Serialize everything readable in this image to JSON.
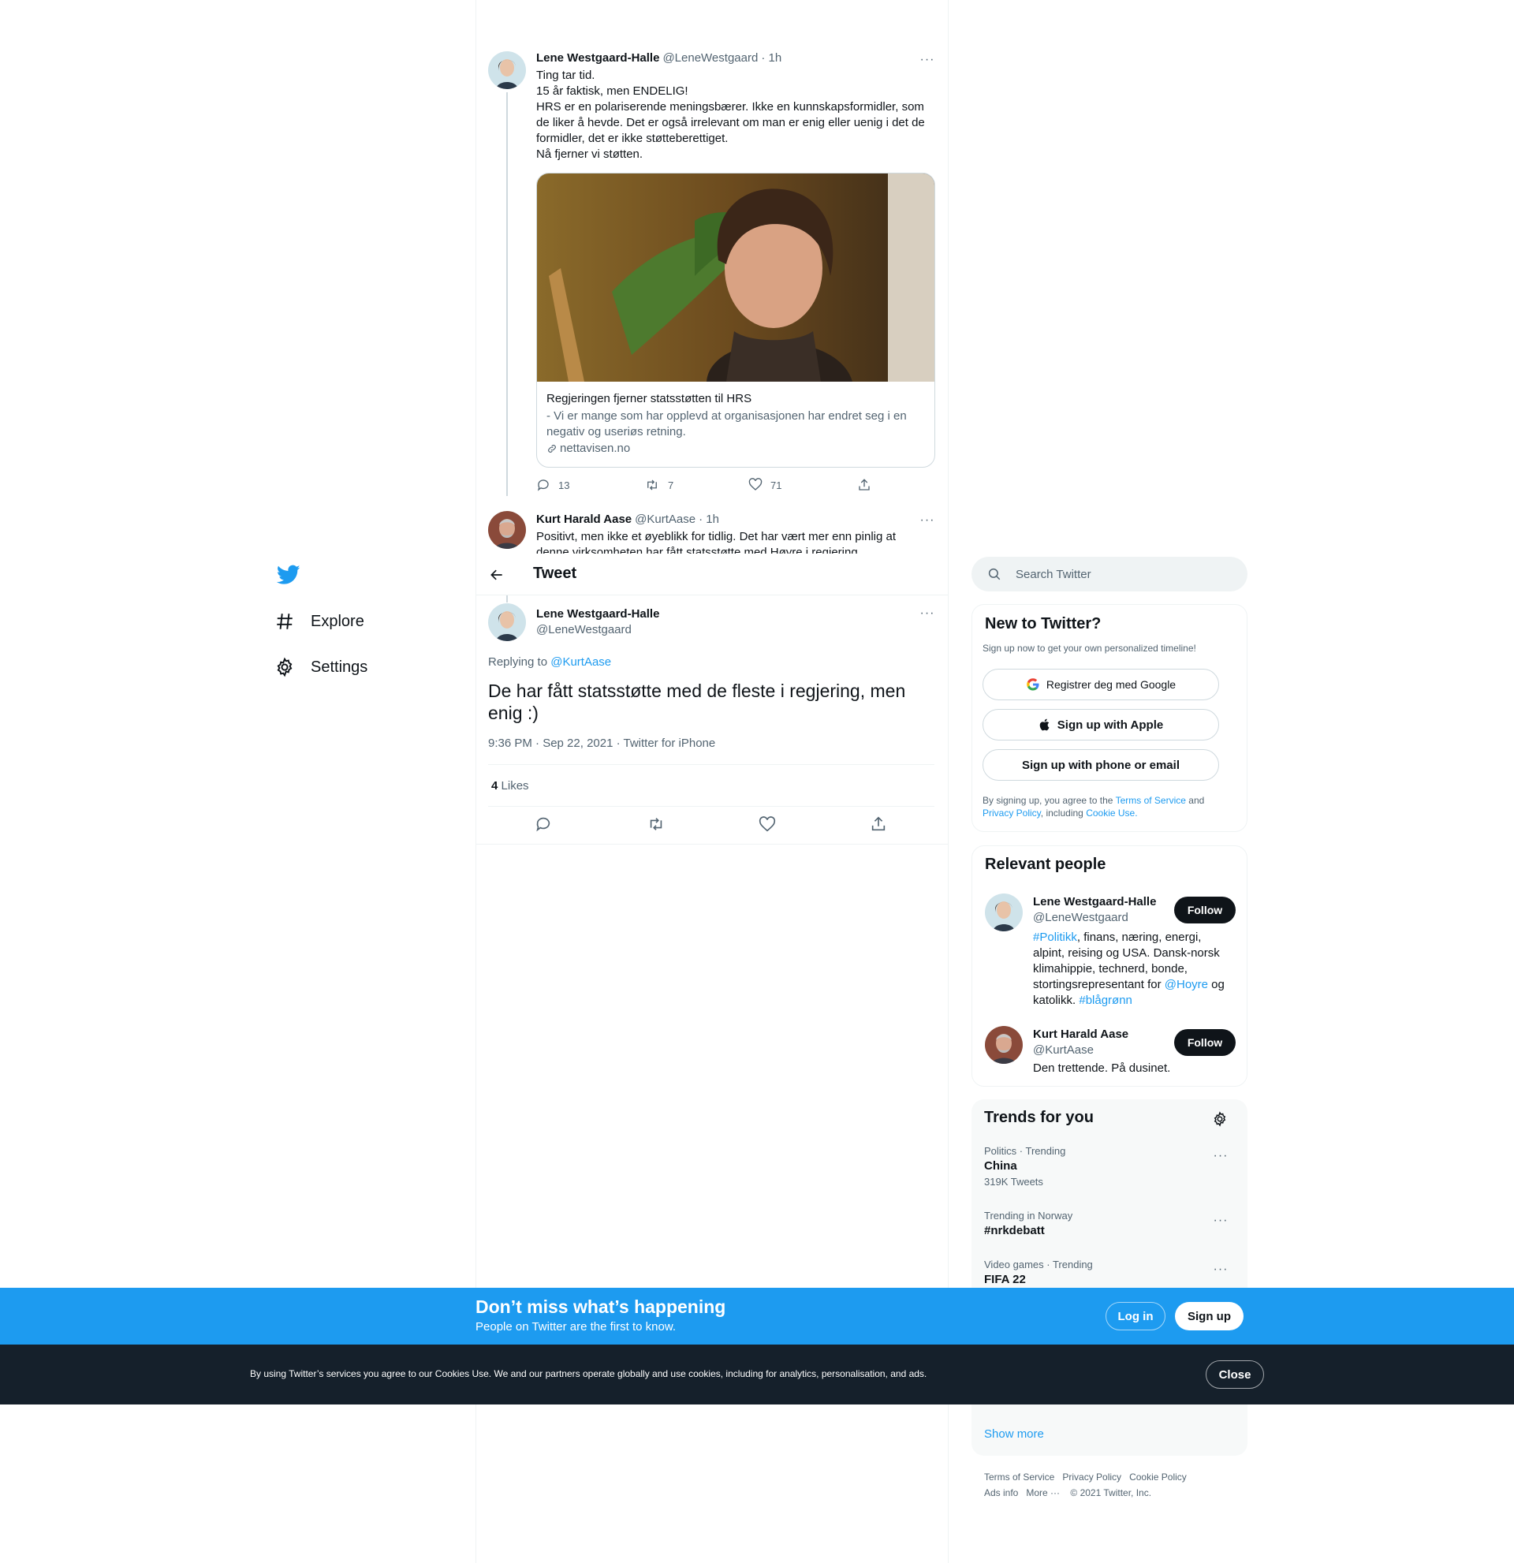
{
  "nav": {
    "explore": "Explore",
    "settings": "Settings"
  },
  "header": {
    "title": "Tweet"
  },
  "parent_tweet": {
    "name": "Lene Westgaard-Halle",
    "handle": "@LeneWestgaard",
    "time": "· 1h",
    "lines": [
      "Ting tar tid.",
      "15 år faktisk, men ENDELIG!",
      "HRS er en polariserende meningsbærer. Ikke en kunnskapsformidler, som de liker å hevde. Det er også irrelevant om man er enig eller uenig i det de formidler, det er ikke støtteberettiget.",
      "Nå fjerner vi støtten."
    ],
    "card": {
      "title": "Regjeringen fjerner statsstøtten til HRS",
      "description": "- Vi er mange som har opplevd at organisasjonen har endret seg i en negativ og useriøs retning.",
      "domain": "nettavisen.no"
    },
    "replies": "13",
    "retweets": "7",
    "likes": "71"
  },
  "mid_tweet": {
    "name": "Kurt Harald Aase",
    "handle": "@KurtAase",
    "time": "· 1h",
    "text": "Positivt, men ikke et øyeblikk for tidlig. Det har vært mer enn pinlig at denne virksomheten har fått statsstøtte med Høyre i regjering."
  },
  "main_tweet": {
    "name": "Lene Westgaard-Halle",
    "handle": "@LeneWestgaard",
    "replying_prefix": "Replying to",
    "replying_to": "@KurtAase",
    "text": "De har fått statsstøtte med de fleste i regjering, men enig :)",
    "timestamp": "9:36 PM · Sep 22, 2021 · Twitter for iPhone",
    "likes_count": "4",
    "likes_label": "Likes"
  },
  "search": {
    "placeholder": "Search Twitter"
  },
  "signup_card": {
    "title": "New to Twitter?",
    "subtitle": "Sign up now to get your own personalized timeline!",
    "google_label": "Registrer deg med Google",
    "apple_label": "Sign up with Apple",
    "phone_label": "Sign up with phone or email",
    "legal_prefix": "By signing up, you agree to the",
    "terms": "Terms of Service",
    "and": "and",
    "privacy": "Privacy Policy",
    "including": ", including",
    "cookie": "Cookie Use."
  },
  "relevant": {
    "title": "Relevant people",
    "people": [
      {
        "name": "Lene Westgaard-Halle",
        "handle": "@LeneWestgaard",
        "follow": "Follow",
        "bio_tag1": "#Politikk",
        "bio_text1": ", finans, næring, energi, alpint, reising og USA. Dansk-norsk klimahippie, technerd, bonde, stortingsrepresentant for ",
        "bio_mention": "@Hoyre",
        "bio_text2": " og katolikk. ",
        "bio_tag2": "#blågrønn"
      },
      {
        "name": "Kurt Harald Aase",
        "handle": "@KurtAase",
        "follow": "Follow",
        "bio": "Den trettende. På dusinet."
      }
    ]
  },
  "trends": {
    "title": "Trends for you",
    "items": [
      {
        "category": "Politics · Trending",
        "name": "China",
        "count": "319K Tweets"
      },
      {
        "category": "Trending in Norway",
        "name": "#nrkdebatt",
        "count": ""
      },
      {
        "category": "Video games · Trending",
        "name": "FIFA 22",
        "count": ""
      }
    ],
    "show_more": "Show more"
  },
  "footer": {
    "terms": "Terms of Service",
    "privacy": "Privacy Policy",
    "cookie": "Cookie Policy",
    "ads": "Ads info",
    "more": "More ···",
    "copyright": "© 2021 Twitter, Inc."
  },
  "banner": {
    "title": "Don’t miss what’s happening",
    "subtitle": "People on Twitter are the first to know.",
    "login": "Log in",
    "signup": "Sign up"
  },
  "cookie_bar": {
    "text": "By using Twitter’s services you agree to our Cookies Use. We and our partners operate globally and use cookies, including for analytics, personalisation, and ads.",
    "close": "Close"
  },
  "colors": {
    "accent": "#1d9bf0",
    "text": "#0f1419",
    "muted": "#536471",
    "dark_bar": "#15202b"
  }
}
